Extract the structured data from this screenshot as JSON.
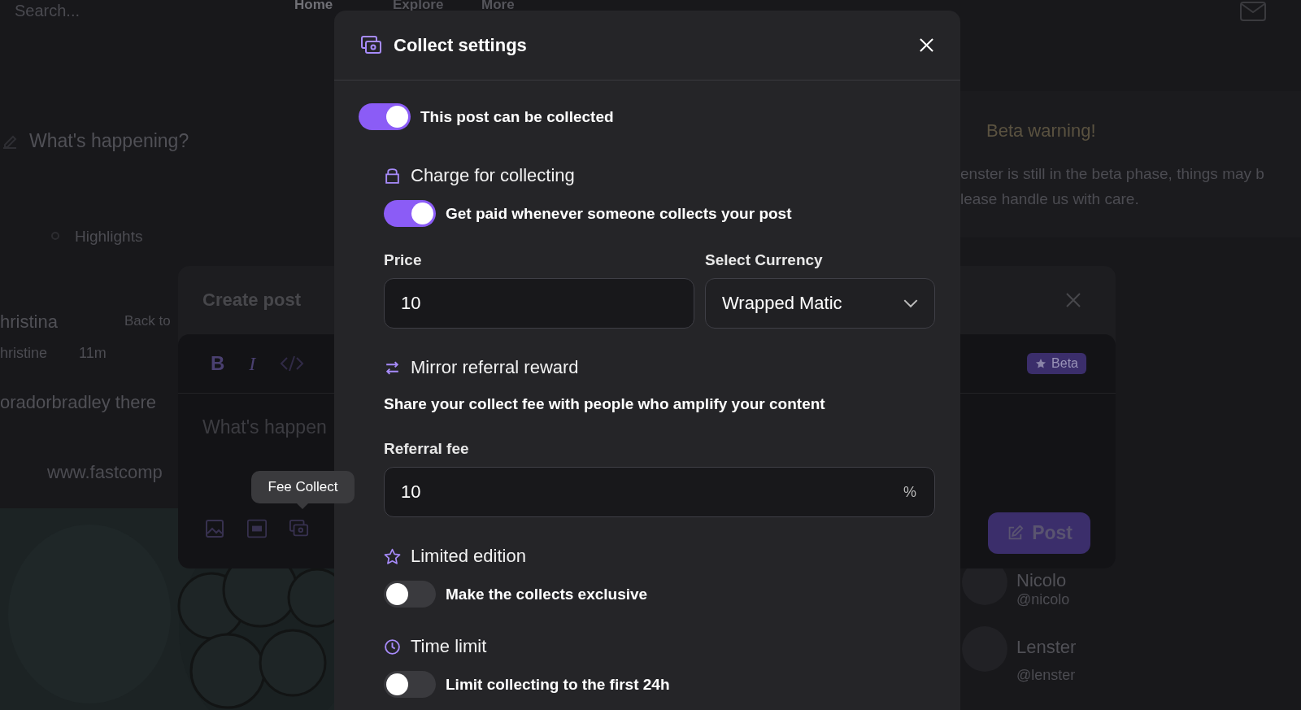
{
  "background": {
    "nav": {
      "search": {
        "placeholder": "Search..."
      },
      "links": [
        {
          "label": "Home",
          "selected": true
        },
        {
          "label": "Explore",
          "selected": false
        },
        {
          "label": "More",
          "selected": false
        }
      ]
    },
    "composer_prompt": "What's happening?",
    "highlights_tab": "Highlights",
    "post": {
      "author": "hristina",
      "back_link": "Back to",
      "handle": "hristine",
      "time": "11m",
      "text": "oradorbradley there",
      "link": "www.fastcomp"
    },
    "beta_warning": {
      "title": "Beta warning!",
      "lines": [
        "enster is still in the beta phase, things may b",
        "lease handle us with care."
      ]
    },
    "suggestions": [
      {
        "name": "Nicolo",
        "handle": "@nicolo"
      },
      {
        "name": "Lenster",
        "handle": "@lenster"
      }
    ]
  },
  "create_post": {
    "title": "Create post",
    "toolbar": [
      "B",
      "I"
    ],
    "badge": "Beta",
    "placeholder": "What's happen",
    "tooltip": "Fee Collect",
    "post_button": "Post"
  },
  "collect_settings": {
    "title": "Collect settings",
    "collectible": {
      "label": "This post can be collected",
      "on": true
    },
    "sections": [
      {
        "kind": "charge",
        "title": "Charge for collecting",
        "toggle": {
          "label": "Get paid whenever someone collects your post",
          "on": true
        },
        "price": {
          "label": "Price",
          "value": "10"
        },
        "currency": {
          "label": "Select Currency",
          "value": "Wrapped Matic"
        }
      },
      {
        "kind": "referral",
        "title": "Mirror referral reward",
        "description": "Share your collect fee with people who amplify your content",
        "fee": {
          "label": "Referral fee",
          "value": "10",
          "unit": "%"
        }
      },
      {
        "kind": "limited",
        "title": "Limited edition",
        "toggle": {
          "label": "Make the collects exclusive",
          "on": false
        }
      },
      {
        "kind": "time",
        "title": "Time limit",
        "toggle": {
          "label": "Limit collecting to the first 24h",
          "on": false
        }
      }
    ]
  }
}
